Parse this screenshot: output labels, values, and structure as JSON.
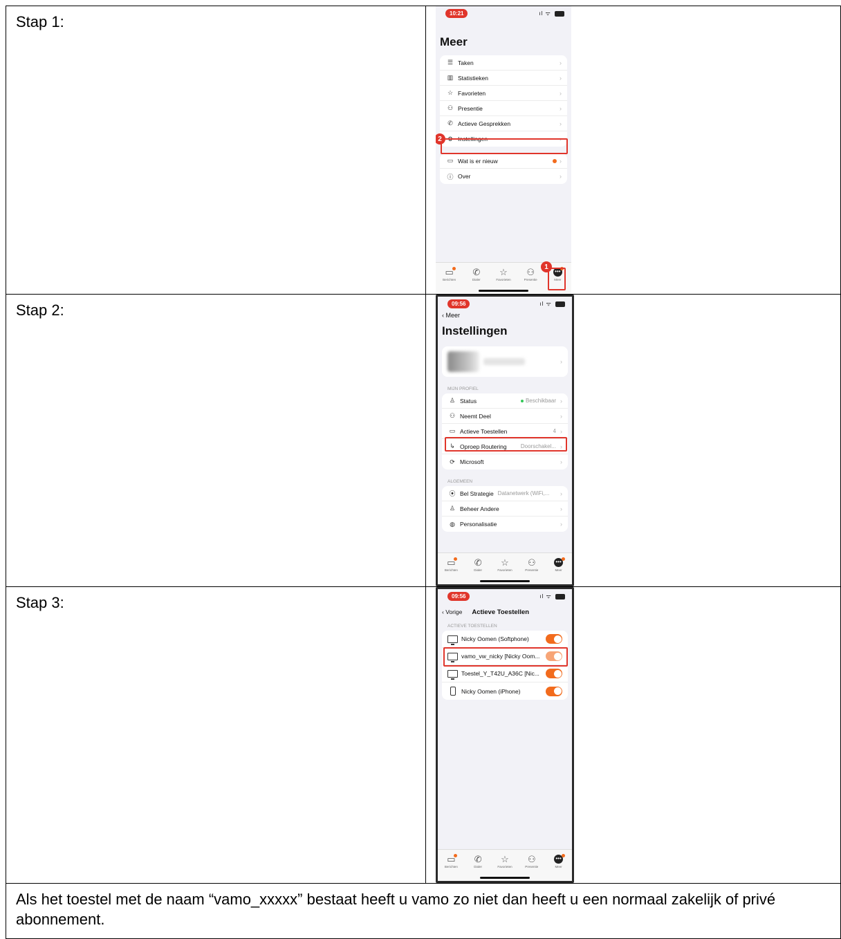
{
  "steps": [
    {
      "label": "Stap 1:"
    },
    {
      "label": "Stap 2:"
    },
    {
      "label": "Stap 3:"
    }
  ],
  "footer_text": "Als het toestel met de naam “vamo_xxxxx” bestaat heeft u vamo zo niet dan heeft u een normaal zakelijk of privé abonnement.",
  "tabbar": {
    "items": [
      {
        "label": "Berichten",
        "icon": "chat-icon"
      },
      {
        "label": "Dialer",
        "icon": "phone-icon"
      },
      {
        "label": "Favorieten",
        "icon": "star-icon"
      },
      {
        "label": "Presentie",
        "icon": "people-icon"
      },
      {
        "label": "Meer",
        "icon": "more-icon"
      }
    ]
  },
  "screen1": {
    "time": "10:21",
    "title": "Meer",
    "menu": [
      {
        "label": "Taken",
        "icon": "tasks-icon"
      },
      {
        "label": "Statistieken",
        "icon": "stats-icon"
      },
      {
        "label": "Favorieten",
        "icon": "star-icon"
      },
      {
        "label": "Presentie",
        "icon": "people-icon"
      },
      {
        "label": "Actieve Gesprekken",
        "icon": "call-icon"
      },
      {
        "label": "Instellingen",
        "icon": "gear-icon"
      }
    ],
    "menu2": [
      {
        "label": "Wat is er nieuw",
        "icon": "folder-icon"
      },
      {
        "label": "Over",
        "icon": "info-icon"
      }
    ],
    "badge1": "1",
    "badge2": "2"
  },
  "screen2": {
    "time": "09:56",
    "back": "Meer",
    "title": "Instellingen",
    "section1": "MIJN PROFIEL",
    "profile_rows": [
      {
        "label": "Status",
        "value": "Beschikbaar",
        "icon": "person-icon"
      },
      {
        "label": "Neemt Deel",
        "value": "",
        "icon": "people-icon"
      },
      {
        "label": "Actieve Toestellen",
        "value": "4",
        "icon": "devices-icon"
      },
      {
        "label": "Oproep Routering",
        "value": "Doorschakel...",
        "icon": "routing-icon"
      },
      {
        "label": "Microsoft",
        "value": "",
        "icon": "sync-icon"
      }
    ],
    "section2": "ALGEMEEN",
    "general_rows": [
      {
        "label": "Bel Strategie",
        "value": "Datanetwerk (WiFi,...",
        "icon": "signal-icon"
      },
      {
        "label": "Beheer Andere",
        "value": "",
        "icon": "manage-icon"
      },
      {
        "label": "Personalisatie",
        "value": "",
        "icon": "palette-icon"
      }
    ]
  },
  "screen3": {
    "time": "09:56",
    "back": "Vorige",
    "title": "Actieve Toestellen",
    "section": "ACTIEVE TOESTELLEN",
    "devices": [
      {
        "label": "Nicky Oomen (Softphone)",
        "icon": "monitor-icon",
        "enabled": true
      },
      {
        "label": "vamo_vw_nicky [Nicky Oom...",
        "icon": "monitor-icon",
        "enabled": true
      },
      {
        "label": "Toestel_Y_T42U_A36C [Nic...",
        "icon": "monitor-icon",
        "enabled": true
      },
      {
        "label": "Nicky Oomen (iPhone)",
        "icon": "iphone-icon",
        "enabled": true
      }
    ]
  }
}
